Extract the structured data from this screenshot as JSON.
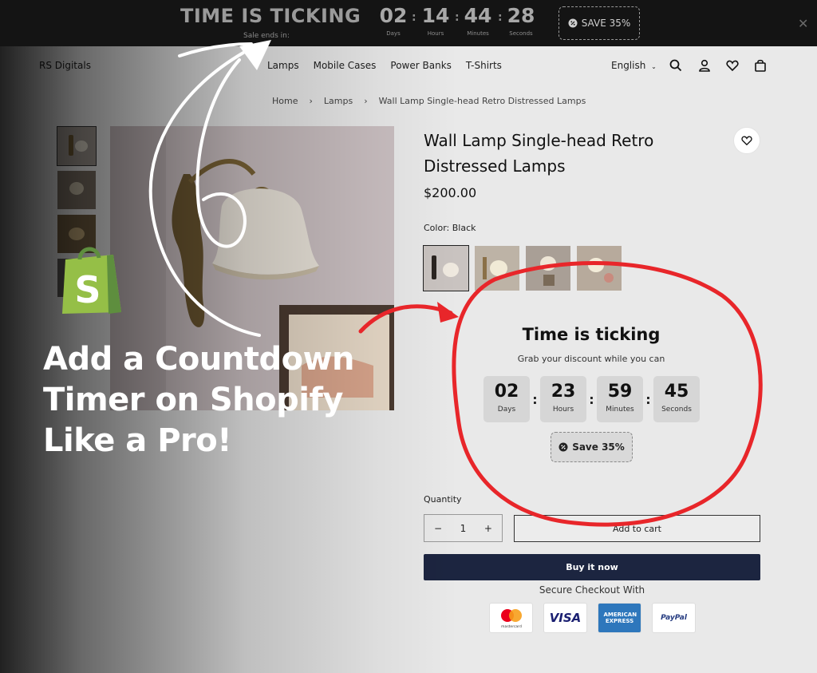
{
  "announcement": {
    "headline": "TIME IS TICKING",
    "ends_in": "Sale ends in:",
    "countdown": [
      {
        "value": "02",
        "label": "Days"
      },
      {
        "value": "14",
        "label": "Hours"
      },
      {
        "value": "44",
        "label": "Minutes"
      },
      {
        "value": "28",
        "label": "Seconds"
      }
    ],
    "save_label": "SAVE 35%",
    "close_icon": "close-icon"
  },
  "header": {
    "brand": "RS Digitals",
    "nav": [
      "Lamps",
      "Mobile Cases",
      "Power Banks",
      "T-Shirts"
    ],
    "language": "English",
    "icons": [
      "search-icon",
      "account-icon",
      "heart-icon",
      "bag-icon"
    ]
  },
  "breadcrumb": {
    "items": [
      "Home",
      "Lamps",
      "Wall Lamp Single-head Retro Distressed Lamps"
    ],
    "separator": "›"
  },
  "product": {
    "title": "Wall Lamp Single-head Retro Distressed Lamps",
    "price": "$200.00",
    "color_label": "Color:",
    "color_value": "Black",
    "quantity_label": "Quantity",
    "quantity": "1",
    "minus": "−",
    "plus": "+",
    "add_to_cart": "Add to cart",
    "buy_now": "Buy it now",
    "secure_checkout": "Secure Checkout With",
    "payments": [
      "mastercard",
      "VISA",
      "AMERICAN EXPRESS",
      "PayPal"
    ]
  },
  "timer_widget": {
    "title": "Time is ticking",
    "subtitle": "Grab your discount while you can",
    "units": [
      {
        "value": "02",
        "label": "Days"
      },
      {
        "value": "23",
        "label": "Hours"
      },
      {
        "value": "59",
        "label": "Minutes"
      },
      {
        "value": "45",
        "label": "Seconds"
      }
    ],
    "save_label": "Save 35%"
  },
  "promo": {
    "line1": "Add a Countdown",
    "line2": "Timer on Shopify",
    "line3": "Like a Pro!",
    "logo": "shopify-logo",
    "logo_letter": "S"
  },
  "colors": {
    "topbar": "#141414",
    "buy_now": "#1c2540",
    "annotation_red": "#e8262a",
    "shopify_green": "#95bf47"
  }
}
